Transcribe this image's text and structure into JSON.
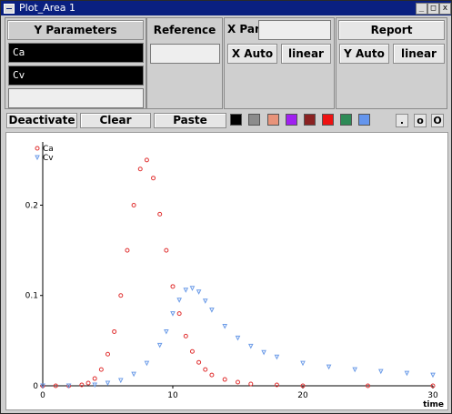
{
  "window": {
    "title": "Plot_Area 1",
    "buttons": [
      "_",
      "□",
      "x"
    ]
  },
  "y_parameters": {
    "header": "Y Parameters",
    "fields": [
      "Ca",
      "Cv",
      ""
    ]
  },
  "reference": {
    "header": "Reference",
    "value": ""
  },
  "x_par": {
    "label": "X Par",
    "value": "",
    "auto_label": "X Auto",
    "scale_label": "linear"
  },
  "report": {
    "header": "Report",
    "auto_label": "Y Auto",
    "scale_label": "linear"
  },
  "toolbar": {
    "deactivate": "Deactivate",
    "clear": "Clear",
    "paste": "Paste",
    "swatches": [
      "#000000",
      "#8c8c8c",
      "#e8937a",
      "#a020f0",
      "#8b2222",
      "#ee1111",
      "#2e8b57",
      "#6495ed"
    ],
    "small_buttons": [
      ".",
      "o",
      "O"
    ]
  },
  "chart_data": {
    "type": "scatter",
    "xlabel": "time",
    "ylabel": "",
    "xlim": [
      0,
      30
    ],
    "ylim": [
      0,
      0.27
    ],
    "x_ticks": [
      0,
      10,
      20,
      30
    ],
    "y_ticks": [
      0,
      0.1,
      0.2
    ],
    "y_tick_labels": [
      "0",
      "0.1",
      "0.2"
    ],
    "legend_position": "top-left",
    "series": [
      {
        "name": "Ca",
        "marker": "circle",
        "color": "#e03030",
        "x": [
          0,
          1,
          2,
          3,
          3.5,
          4,
          4.5,
          5,
          5.5,
          6,
          6.5,
          7,
          7.5,
          8,
          8.5,
          9,
          9.5,
          10,
          10.5,
          11,
          11.5,
          12,
          12.5,
          13,
          14,
          15,
          16,
          18,
          20,
          25,
          30
        ],
        "y": [
          0,
          0,
          0,
          0.001,
          0.003,
          0.008,
          0.018,
          0.035,
          0.06,
          0.1,
          0.15,
          0.2,
          0.24,
          0.25,
          0.23,
          0.19,
          0.15,
          0.11,
          0.08,
          0.055,
          0.038,
          0.026,
          0.018,
          0.012,
          0.007,
          0.004,
          0.002,
          0.001,
          0,
          0,
          0
        ]
      },
      {
        "name": "Cv",
        "marker": "triangle",
        "color": "#6b9be8",
        "x": [
          0,
          2,
          4,
          5,
          6,
          7,
          8,
          9,
          9.5,
          10,
          10.5,
          11,
          11.5,
          12,
          12.5,
          13,
          14,
          15,
          16,
          17,
          18,
          20,
          22,
          24,
          26,
          28,
          30
        ],
        "y": [
          0,
          0,
          0.001,
          0.003,
          0.006,
          0.013,
          0.025,
          0.045,
          0.06,
          0.08,
          0.095,
          0.106,
          0.108,
          0.104,
          0.094,
          0.084,
          0.066,
          0.053,
          0.044,
          0.037,
          0.032,
          0.025,
          0.021,
          0.018,
          0.016,
          0.014,
          0.012
        ]
      }
    ]
  }
}
